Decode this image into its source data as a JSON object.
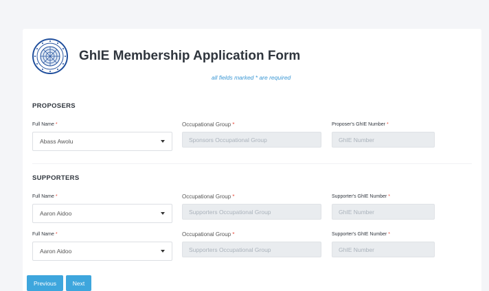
{
  "header": {
    "title": "GhIE Membership Application Form",
    "required_note": "all fields marked * are required",
    "logo_name": "ghie-seal-logo"
  },
  "required_mark": "*",
  "proposers": {
    "section_title": "PROPOSERS",
    "rows": [
      {
        "name_label": "Full Name",
        "name_value": "Abass Awolu",
        "occ_label": "Occupational Group",
        "occ_placeholder": "Sponsors Occupational Group",
        "num_label": "Proposer's GhIE Number",
        "num_placeholder": "GhIE Number"
      }
    ]
  },
  "supporters": {
    "section_title": "SUPPORTERS",
    "rows": [
      {
        "name_label": "Full Name",
        "name_value": "Aaron Aidoo",
        "occ_label": "Occupational Group",
        "occ_placeholder": "Supporters Occupational Group",
        "num_label": "Supporter's GhIE Number",
        "num_placeholder": "GhIE Number"
      },
      {
        "name_label": "Full Name",
        "name_value": "Aaron Aidoo",
        "occ_label": "Occupational Group",
        "occ_placeholder": "Supporters Occupational Group",
        "num_label": "Supporter's GhIE Number",
        "num_placeholder": "GhIE Number"
      }
    ]
  },
  "actions": {
    "previous_label": "Previous",
    "next_label": "Next"
  },
  "colors": {
    "accent": "#3ea6dd",
    "required": "#e74c3c",
    "note": "#3a97d4",
    "logo": "#1f4e9c"
  }
}
